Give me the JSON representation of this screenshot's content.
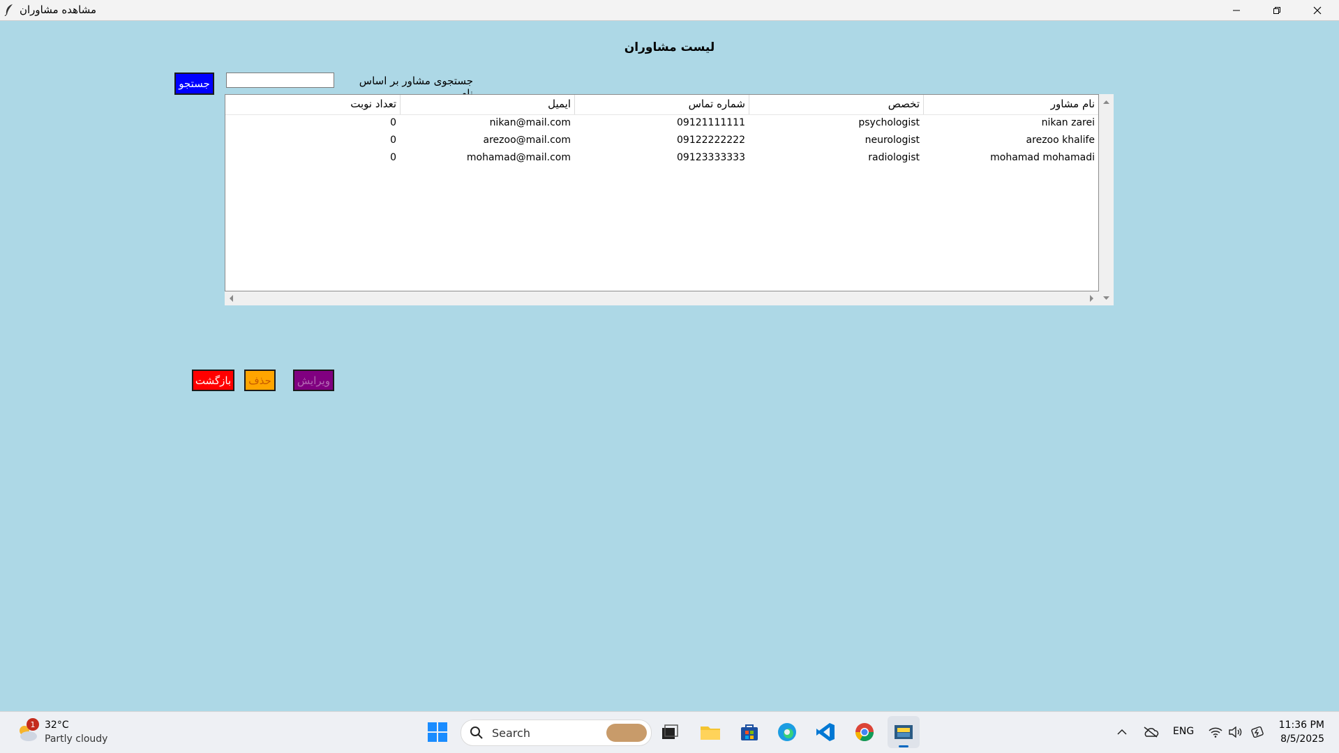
{
  "window": {
    "title": "مشاهده مشاوران",
    "controls": [
      "minimize-icon",
      "restore-icon",
      "close-icon"
    ]
  },
  "page": {
    "heading": "لیست مشاوران",
    "search_label": "جستجوی مشاور بر اساس نام",
    "search_value": "",
    "search_button": "جستجو"
  },
  "table": {
    "columns": [
      "نام مشاور",
      "تخصص",
      "شماره تماس",
      "ایمیل",
      "تعداد نوبت"
    ],
    "rows": [
      {
        "name": "nikan zarei",
        "specialty": "psychologist",
        "phone": "09121111111",
        "email": "nikan@mail.com",
        "appointments": "0"
      },
      {
        "name": "arezoo khalife",
        "specialty": "neurologist",
        "phone": "09122222222",
        "email": "arezoo@mail.com",
        "appointments": "0"
      },
      {
        "name": "mohamad mohamadi",
        "specialty": "radiologist",
        "phone": "09123333333",
        "email": "mohamad@mail.com",
        "appointments": "0"
      }
    ]
  },
  "actions": {
    "back": "بازگشت",
    "delete": "حذف",
    "edit": "ویرایش"
  },
  "colors": {
    "background": "#add8e6",
    "search_button": "#0000ff",
    "back_button": "#ff0000",
    "delete_button": "#ffa500",
    "edit_button": "#800080"
  },
  "taskbar": {
    "weather_badge": "1",
    "temperature": "32°C",
    "weather": "Partly cloudy",
    "search_placeholder": "Search",
    "language": "ENG",
    "time": "11:36 PM",
    "date": "8/5/2025"
  }
}
